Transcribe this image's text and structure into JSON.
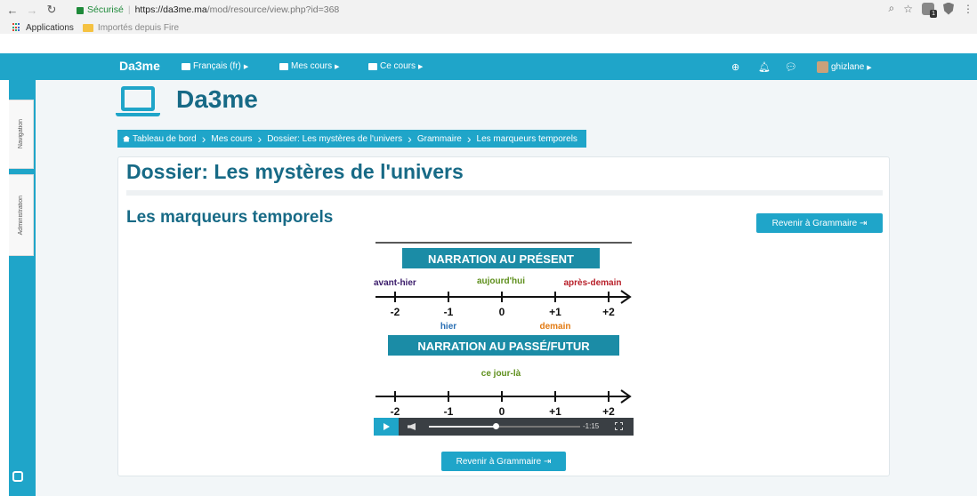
{
  "browser": {
    "secure_label": "Sécurisé",
    "url_host": "https://da3me.ma",
    "url_path": "/mod/resource/view.php?id=368",
    "extension_badge": "1",
    "bookmarks": [
      "Applications",
      "Importés depuis Fire"
    ]
  },
  "navbar": {
    "brand": "Da3me",
    "items": [
      {
        "label": "Français (fr)"
      },
      {
        "label": "Mes cours"
      },
      {
        "label": "Ce cours"
      }
    ],
    "user": "ghizlane"
  },
  "site": {
    "title": "Da3me"
  },
  "side_tabs": {
    "navigation": "Navigation",
    "administration": "Administration"
  },
  "breadcrumb": [
    "Tableau de bord",
    "Mes cours",
    "Dossier: Les mystères de l'univers",
    "Grammaire",
    "Les marqueurs temporels"
  ],
  "page": {
    "course_title": "Dossier: Les mystères de l'univers",
    "resource_title": "Les marqueurs temporels",
    "back_button_label": "Revenir à Grammaire"
  },
  "video": {
    "frame": {
      "present_heading": "NARRATION AU PRÉSENT",
      "past_future_heading": "NARRATION AU PASSÉ/FUTUR",
      "present_words": {
        "avant_hier": "avant-hier",
        "aujourdhui": "aujourd'hui",
        "apres_demain": "après-demain",
        "hier": "hier",
        "demain": "demain"
      },
      "past_future_word": "ce jour-là",
      "axis_ticks": [
        "-2",
        "-1",
        "0",
        "+1",
        "+2"
      ]
    },
    "time_remaining": "-1:15",
    "progress": 0.44
  },
  "colors": {
    "brand": "#1fa5c9",
    "title": "#176a86",
    "heading_bg": "#1b8ca6",
    "word_dark": "#3b1c6b",
    "word_green": "#5e8f1c",
    "word_red": "#b8202a",
    "word_blue": "#2a6fb3",
    "word_orange": "#e27a12"
  }
}
